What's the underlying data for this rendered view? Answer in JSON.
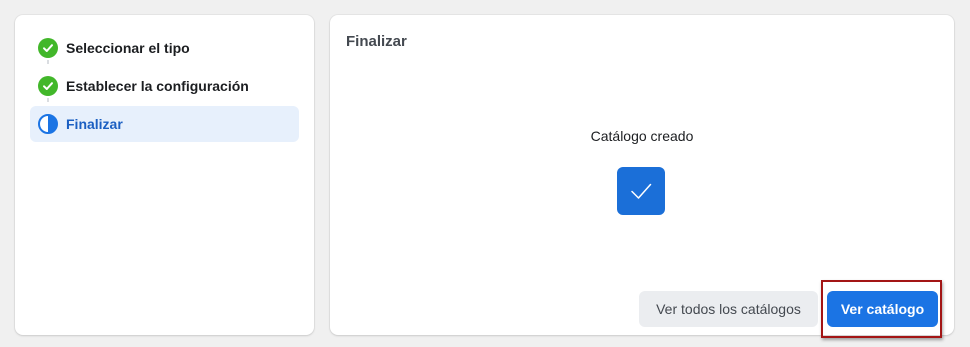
{
  "steps": [
    {
      "label": "Seleccionar el tipo",
      "status": "done",
      "icon": "check-circle-icon"
    },
    {
      "label": "Establecer la configuración",
      "status": "done",
      "icon": "check-circle-icon"
    },
    {
      "label": "Finalizar",
      "status": "active",
      "icon": "half-circle-icon"
    }
  ],
  "main": {
    "title": "Finalizar",
    "success_text": "Catálogo creado",
    "success_icon": "checkmark-icon",
    "secondary_button": "Ver todos los catálogos",
    "primary_button": "Ver catálogo"
  },
  "colors": {
    "accent": "#1b74e4",
    "success": "#42b72a",
    "highlight_border": "#a31515"
  }
}
